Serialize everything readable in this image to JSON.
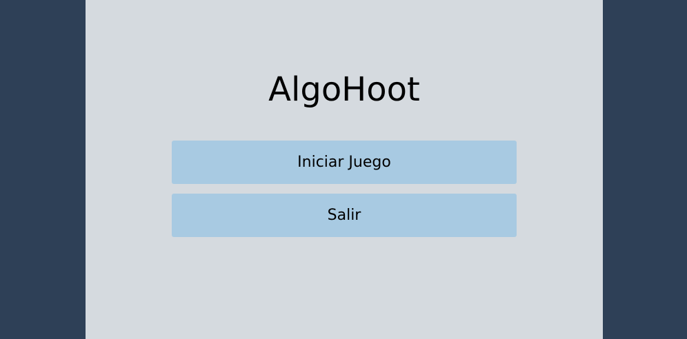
{
  "app": {
    "title": "AlgoHoot"
  },
  "menu": {
    "start_label": "Iniciar Juego",
    "exit_label": "Salir"
  },
  "colors": {
    "background": "#2e4057",
    "panel": "#d5dadf",
    "button": "#a8cae2",
    "text": "#000000"
  }
}
